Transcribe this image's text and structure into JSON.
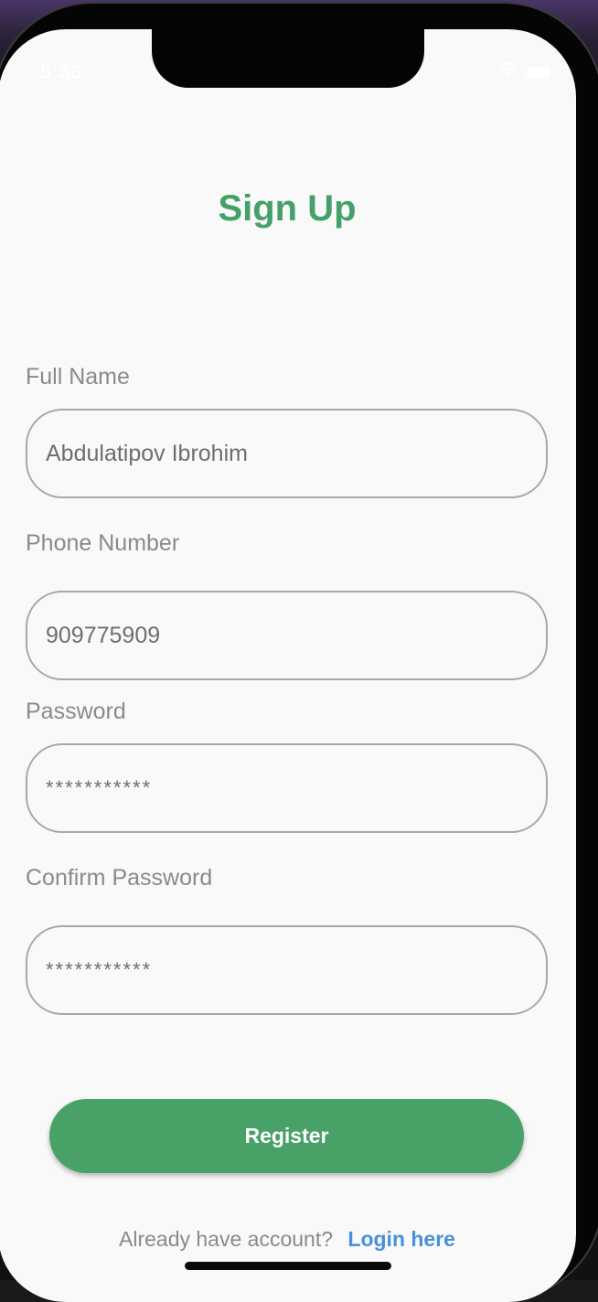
{
  "status_bar": {
    "time": "5:36",
    "wifi_icon": "wifi-icon",
    "battery_icon": "battery-icon"
  },
  "page": {
    "title": "Sign Up"
  },
  "form": {
    "full_name": {
      "label": "Full Name",
      "value": "Abdulatipov Ibrohim"
    },
    "phone": {
      "label": "Phone Number",
      "value": "909775909"
    },
    "password": {
      "label": "Password",
      "value": "***********"
    },
    "confirm_password": {
      "label": "Confirm Password",
      "value": "***********"
    }
  },
  "actions": {
    "register_label": "Register",
    "login_prompt": "Already have account?",
    "login_link": "Login here"
  },
  "colors": {
    "accent_green": "#48a268",
    "link_blue": "#4a90d9",
    "label_gray": "#8a8a8a",
    "border_gray": "#a8a8a8",
    "background": "#f9f9f9"
  }
}
